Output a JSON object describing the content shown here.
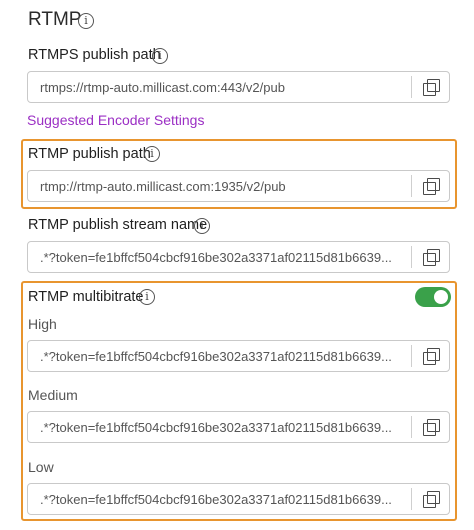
{
  "section": {
    "title": "RTMP"
  },
  "rtmps_publish_path": {
    "label": "RTMPS publish path",
    "value": "rtmps://rtmp-auto.millicast.com:443/v2/pub"
  },
  "suggested_encoder_settings": {
    "label": "Suggested Encoder Settings"
  },
  "rtmp_publish_path": {
    "label": "RTMP publish path",
    "value": "rtmp://rtmp-auto.millicast.com:1935/v2/pub"
  },
  "rtmp_publish_stream_name": {
    "label": "RTMP publish stream name",
    "value": ".*?token=fe1bffcf504cbcf916be302a3371af02115d81b6639..."
  },
  "rtmp_multibitrate": {
    "label": "RTMP multibitrate",
    "enabled": true,
    "high": {
      "label": "High",
      "value": ".*?token=fe1bffcf504cbcf916be302a3371af02115d81b6639..."
    },
    "medium": {
      "label": "Medium",
      "value": ".*?token=fe1bffcf504cbcf916be302a3371af02115d81b6639..."
    },
    "low": {
      "label": "Low",
      "value": ".*?token=fe1bffcf504cbcf916be302a3371af02115d81b6639..."
    }
  },
  "icons": {
    "info": "info-icon",
    "copy": "copy-icon"
  },
  "colors": {
    "highlight": "#e8952f",
    "link": "#9b2fc4",
    "toggle_on": "#3aa14a"
  }
}
